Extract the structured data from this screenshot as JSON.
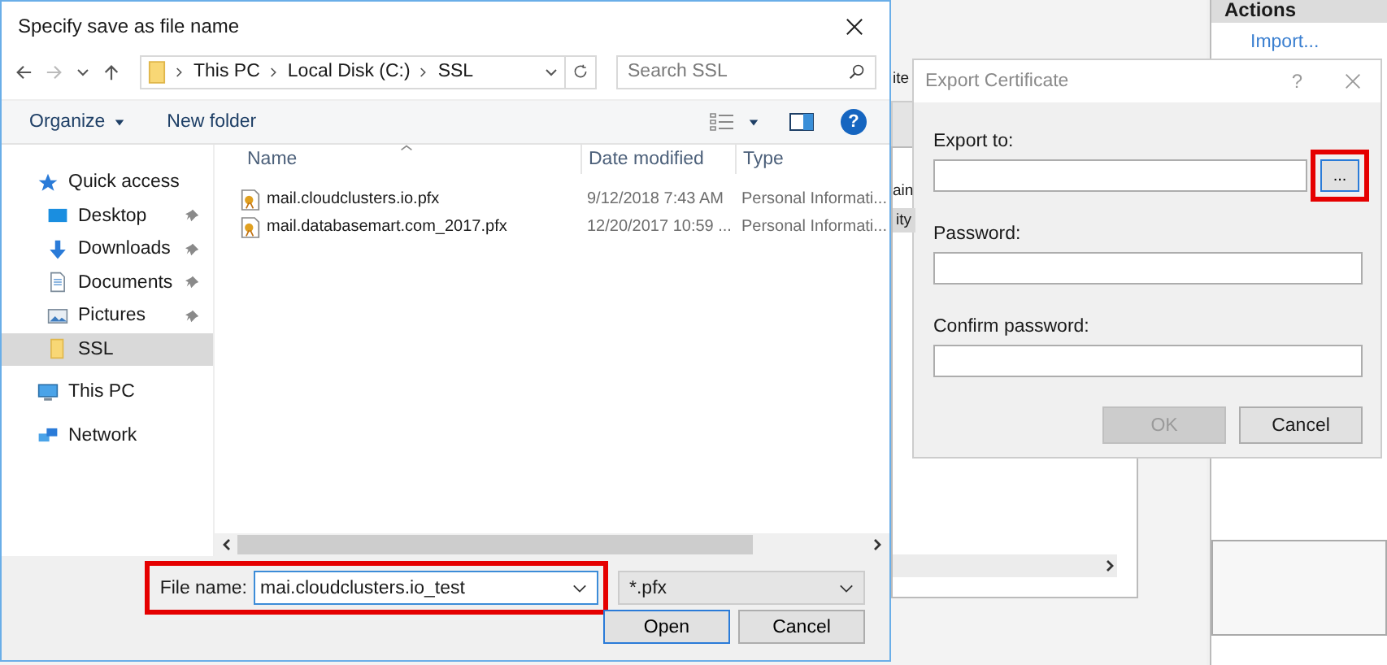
{
  "background_window": {
    "partial_texts": [
      "ite",
      "ain",
      "ity"
    ],
    "actions_title": "Actions",
    "actions_links": [
      "Import..."
    ]
  },
  "save_dialog": {
    "title": "Specify save as file name",
    "breadcrumb": [
      "This PC",
      "Local Disk (C:)",
      "SSL"
    ],
    "search": {
      "placeholder": "Search SSL"
    },
    "toolbar": [
      {
        "label": "Organize",
        "has_menu": true
      },
      {
        "label": "New folder",
        "has_menu": false
      }
    ],
    "help_glyph": "?",
    "sidebar": [
      {
        "label": "Quick access",
        "kind": "star",
        "selected": false,
        "children": [
          {
            "label": "Desktop",
            "kind": "desktop",
            "pinned": true,
            "selected": false
          },
          {
            "label": "Downloads",
            "kind": "download",
            "pinned": true,
            "selected": false
          },
          {
            "label": "Documents",
            "kind": "document",
            "pinned": true,
            "selected": false
          },
          {
            "label": "Pictures",
            "kind": "pictures",
            "pinned": true,
            "selected": false
          },
          {
            "label": "SSL",
            "kind": "folder",
            "pinned": false,
            "selected": true
          }
        ]
      },
      {
        "label": "This PC",
        "kind": "pc",
        "selected": false
      },
      {
        "label": "Network",
        "kind": "network",
        "selected": false
      }
    ],
    "columns": [
      "Name",
      "Date modified",
      "Type"
    ],
    "rows": [
      {
        "name": "mail.cloudclusters.io.pfx",
        "date": "9/12/2018 7:43 AM",
        "type": "Personal Informati..."
      },
      {
        "name": "mail.databasemart.com_2017.pfx",
        "date": "12/20/2017 10:59 ...",
        "type": "Personal Informati..."
      }
    ],
    "file_name": {
      "label": "File name:",
      "value": "mai.cloudclusters.io_test",
      "highlighted": true
    },
    "file_type": "*.pfx",
    "buttons": [
      "Open",
      "Cancel"
    ]
  },
  "export_dialog": {
    "title": "Export Certificate",
    "help_glyph": "?",
    "fields": [
      {
        "label": "Export to:",
        "browse": "...",
        "highlighted": true
      },
      {
        "label": "Password:"
      },
      {
        "label": "Confirm password:"
      }
    ],
    "buttons": [
      {
        "label": "OK",
        "disabled": true
      },
      {
        "label": "Cancel",
        "disabled": false
      }
    ]
  }
}
